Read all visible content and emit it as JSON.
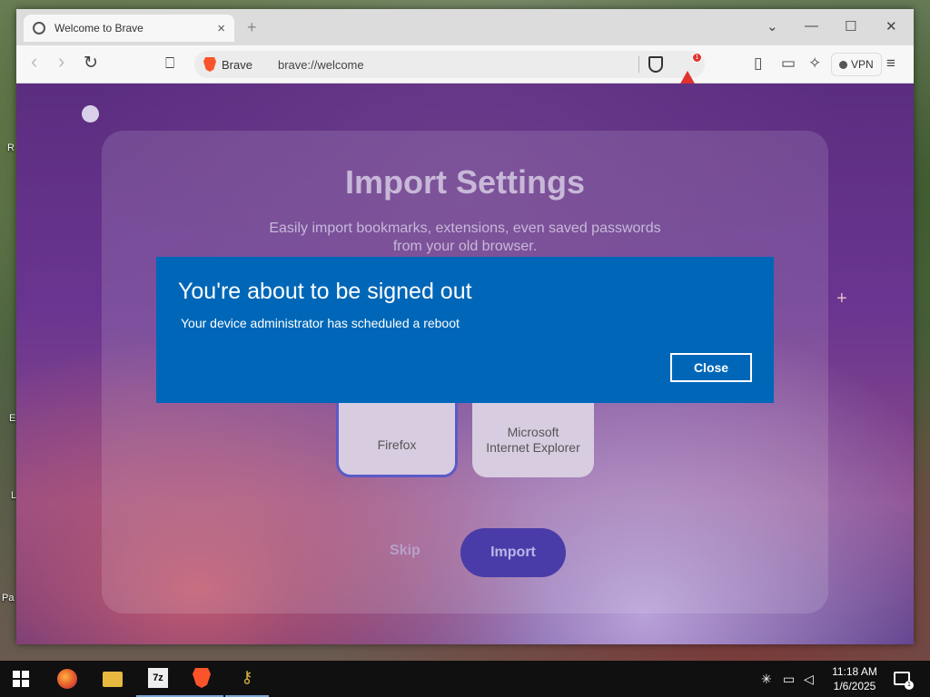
{
  "desktop": {
    "labels": [
      "R",
      "E",
      "L",
      "Pa"
    ]
  },
  "browser": {
    "tab": {
      "title": "Welcome to Brave",
      "close": "×"
    },
    "new_tab": "+",
    "window_controls": {
      "list": "⌄",
      "minimize": "—",
      "maximize": "☐",
      "close": "✕"
    },
    "nav": {
      "back": "‹",
      "forward": "›",
      "reload": "↻",
      "bookmark": "⎕"
    },
    "address": {
      "site": "Brave",
      "url": "brave://welcome"
    },
    "rewards_badge": "1",
    "vpn_label": "VPN",
    "menu": "≡"
  },
  "page": {
    "title": "Import Settings",
    "subtitle_line1": "Easily import bookmarks, extensions, even saved passwords",
    "subtitle_line2": "from your old browser.",
    "sparkle": "+",
    "browsers": [
      {
        "label": "Firefox",
        "selected": true
      },
      {
        "label_line1": "Microsoft",
        "label_line2": "Internet Explorer",
        "selected": false
      }
    ],
    "skip_label": "Skip",
    "import_label": "Import"
  },
  "dialog": {
    "title": "You're about to be signed out",
    "message": "Your device administrator has scheduled a reboot",
    "close_label": "Close",
    "color": "#0067b8"
  },
  "taskbar": {
    "apps": [
      "firefox-icon",
      "file-explorer-icon",
      "7zip-icon",
      "brave-icon",
      "keys-icon"
    ],
    "sevenzip_text": "7z",
    "clock_time": "11:18 AM",
    "clock_date": "1/6/2025",
    "notification_count": "1"
  }
}
